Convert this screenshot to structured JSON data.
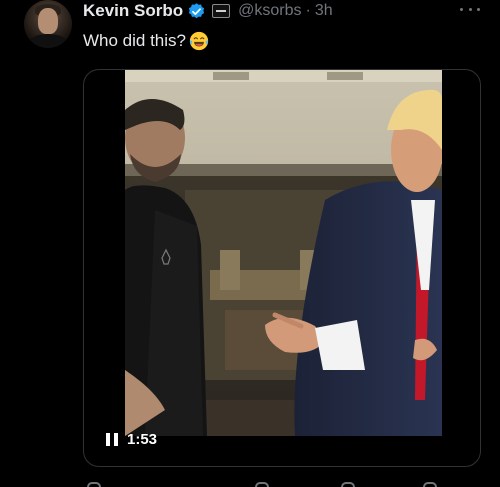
{
  "tweet": {
    "display_name": "Kevin Sorbo",
    "handle": "@ksorbs",
    "separator": "·",
    "timestamp": "3h",
    "text": "Who did this?",
    "emoji": "face-with-tears-of-joy",
    "verified": true
  },
  "video": {
    "duration": "1:53",
    "state": "playing"
  },
  "colors": {
    "background": "#000000",
    "primary_text": "#e7e9ea",
    "secondary_text": "#71767b",
    "verified_blue": "#1d9bf0",
    "border": "#2f3336"
  },
  "icons": {
    "more": "more-icon",
    "verified": "verified-icon",
    "affiliate": "affiliate-badge-icon",
    "pause": "pause-icon"
  }
}
